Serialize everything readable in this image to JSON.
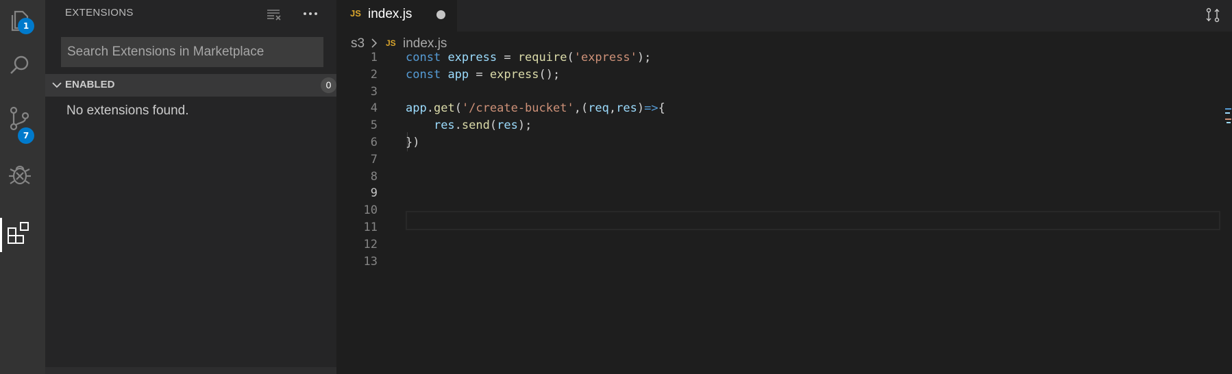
{
  "activity_bar": {
    "explorer_badge": "1",
    "scm_badge": "7",
    "active": "extensions"
  },
  "sidebar": {
    "title": "EXTENSIONS",
    "search_placeholder": "Search Extensions in Marketplace",
    "search_value": "",
    "section_title": "ENABLED",
    "section_count": "0",
    "empty_message": "No extensions found."
  },
  "tabs": [
    {
      "icon": "JS",
      "label": "index.js",
      "dirty": true
    }
  ],
  "breadcrumb": {
    "folder": "s3",
    "file_icon": "JS",
    "file": "index.js"
  },
  "editor": {
    "line_numbers": [
      "1",
      "2",
      "3",
      "4",
      "5",
      "6",
      "7",
      "8",
      "9",
      "10",
      "11",
      "12",
      "13"
    ],
    "current_line": 9,
    "lines": [
      [
        {
          "t": "const",
          "c": "kw"
        },
        {
          "t": " ",
          "c": "punc"
        },
        {
          "t": "express",
          "c": "var"
        },
        {
          "t": " = ",
          "c": "punc"
        },
        {
          "t": "require",
          "c": "fn"
        },
        {
          "t": "(",
          "c": "punc"
        },
        {
          "t": "'express'",
          "c": "str"
        },
        {
          "t": ");",
          "c": "punc"
        }
      ],
      [
        {
          "t": "const",
          "c": "kw"
        },
        {
          "t": " ",
          "c": "punc"
        },
        {
          "t": "app",
          "c": "var"
        },
        {
          "t": " = ",
          "c": "punc"
        },
        {
          "t": "express",
          "c": "fn"
        },
        {
          "t": "();",
          "c": "punc"
        }
      ],
      [],
      [
        {
          "t": "app",
          "c": "var"
        },
        {
          "t": ".",
          "c": "punc"
        },
        {
          "t": "get",
          "c": "fn"
        },
        {
          "t": "(",
          "c": "punc"
        },
        {
          "t": "'/create-bucket'",
          "c": "str"
        },
        {
          "t": ",(",
          "c": "punc"
        },
        {
          "t": "req",
          "c": "var"
        },
        {
          "t": ",",
          "c": "punc"
        },
        {
          "t": "res",
          "c": "var"
        },
        {
          "t": ")",
          "c": "punc"
        },
        {
          "t": "=>",
          "c": "kw"
        },
        {
          "t": "{",
          "c": "punc"
        }
      ],
      [
        {
          "t": "    ",
          "c": "punc"
        },
        {
          "t": "res",
          "c": "var"
        },
        {
          "t": ".",
          "c": "punc"
        },
        {
          "t": "send",
          "c": "fn"
        },
        {
          "t": "(",
          "c": "punc"
        },
        {
          "t": "res",
          "c": "var"
        },
        {
          "t": ");",
          "c": "punc"
        }
      ],
      [
        {
          "t": "})",
          "c": "punc"
        }
      ],
      [],
      [],
      [],
      [],
      [],
      [],
      []
    ]
  },
  "colors": {
    "accent": "#007acc",
    "keyword": "#569cd6",
    "variable": "#9cdcfe",
    "function": "#dcdcaa",
    "string": "#ce9178",
    "js_icon": "#d9a52c"
  }
}
